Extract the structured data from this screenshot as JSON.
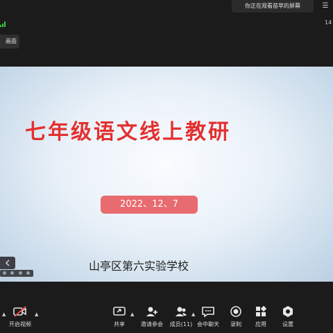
{
  "banner": {
    "text": "你正在观看苗苹的屏幕",
    "menu_icon": "menu-icon"
  },
  "status": {
    "time": "14"
  },
  "view_button": {
    "label": "画面"
  },
  "slide": {
    "title": "七年级语文线上教研",
    "date": "2022、12、7",
    "school": "山亭区第六实验学校",
    "colors": {
      "title": "#e33030",
      "date_pill": "#e86b6f"
    }
  },
  "toolbar": {
    "video": {
      "label": "开启视频",
      "icon": "video-off-icon"
    },
    "share": {
      "label": "共享",
      "icon": "share-screen-icon"
    },
    "invite": {
      "label": "邀请参会",
      "icon": "invite-icon"
    },
    "members": {
      "label": "成员(11)",
      "icon": "members-icon"
    },
    "chat": {
      "label": "会中聊天",
      "icon": "chat-icon"
    },
    "record": {
      "label": "录制",
      "icon": "record-icon"
    },
    "apps": {
      "label": "应用",
      "icon": "apps-icon"
    },
    "settings": {
      "label": "设置",
      "icon": "settings-icon"
    }
  }
}
